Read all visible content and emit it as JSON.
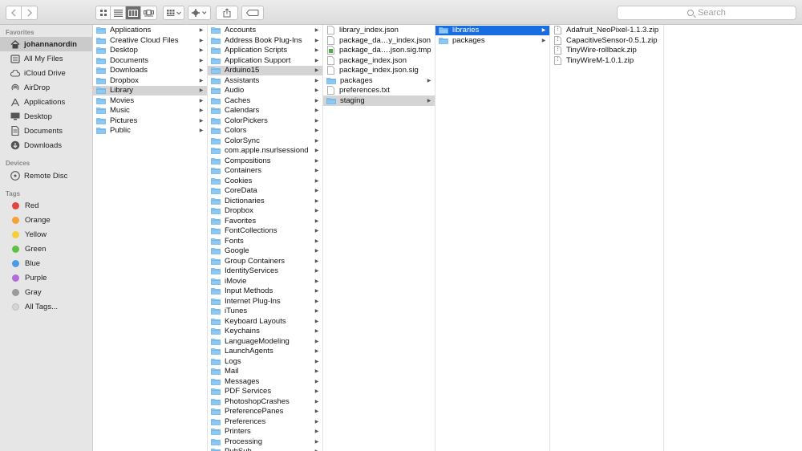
{
  "toolbar": {
    "back_icon": "chevron-left",
    "forward_icon": "chevron-right",
    "view_modes": [
      "icon-view",
      "list-view",
      "column-view",
      "cover-flow-view"
    ],
    "active_view": "column-view",
    "arrange_icon": "grid-arrange",
    "action_icon": "gear",
    "share_icon": "share",
    "tags_icon": "tag",
    "search_placeholder": "Search"
  },
  "sidebar": {
    "favorites_heading": "Favorites",
    "favorites": [
      {
        "label": "johannanordin",
        "icon": "home",
        "selected": true
      },
      {
        "label": "All My Files",
        "icon": "all-files"
      },
      {
        "label": "iCloud Drive",
        "icon": "cloud"
      },
      {
        "label": "AirDrop",
        "icon": "airdrop"
      },
      {
        "label": "Applications",
        "icon": "applications"
      },
      {
        "label": "Desktop",
        "icon": "desktop"
      },
      {
        "label": "Documents",
        "icon": "document"
      },
      {
        "label": "Downloads",
        "icon": "download"
      }
    ],
    "devices_heading": "Devices",
    "devices": [
      {
        "label": "Remote Disc",
        "icon": "disc"
      }
    ],
    "tags_heading": "Tags",
    "tags": [
      {
        "label": "Red",
        "color": "#e0443e"
      },
      {
        "label": "Orange",
        "color": "#f5a236"
      },
      {
        "label": "Yellow",
        "color": "#f3cf3a"
      },
      {
        "label": "Green",
        "color": "#5ec145"
      },
      {
        "label": "Blue",
        "color": "#4a9de2"
      },
      {
        "label": "Purple",
        "color": "#b26cd8"
      },
      {
        "label": "Gray",
        "color": "#9b9b9b"
      },
      {
        "label": "All Tags...",
        "color": "#d4d4d4"
      }
    ]
  },
  "columns": [
    {
      "items": [
        {
          "label": "Applications",
          "type": "folder"
        },
        {
          "label": "Creative Cloud Files",
          "type": "folder"
        },
        {
          "label": "Desktop",
          "type": "folder"
        },
        {
          "label": "Documents",
          "type": "folder"
        },
        {
          "label": "Downloads",
          "type": "folder"
        },
        {
          "label": "Dropbox",
          "type": "folder"
        },
        {
          "label": "Library",
          "type": "folder",
          "state": "gray"
        },
        {
          "label": "Movies",
          "type": "folder"
        },
        {
          "label": "Music",
          "type": "folder"
        },
        {
          "label": "Pictures",
          "type": "folder"
        },
        {
          "label": "Public",
          "type": "folder"
        }
      ]
    },
    {
      "items": [
        {
          "label": "Accounts",
          "type": "folder"
        },
        {
          "label": "Address Book Plug-Ins",
          "type": "folder"
        },
        {
          "label": "Application Scripts",
          "type": "folder"
        },
        {
          "label": "Application Support",
          "type": "folder"
        },
        {
          "label": "Arduino15",
          "type": "folder",
          "state": "gray"
        },
        {
          "label": "Assistants",
          "type": "folder"
        },
        {
          "label": "Audio",
          "type": "folder"
        },
        {
          "label": "Caches",
          "type": "folder"
        },
        {
          "label": "Calendars",
          "type": "folder"
        },
        {
          "label": "ColorPickers",
          "type": "folder"
        },
        {
          "label": "Colors",
          "type": "folder"
        },
        {
          "label": "ColorSync",
          "type": "folder"
        },
        {
          "label": "com.apple.nsurlsessiond",
          "type": "folder"
        },
        {
          "label": "Compositions",
          "type": "folder"
        },
        {
          "label": "Containers",
          "type": "folder"
        },
        {
          "label": "Cookies",
          "type": "folder"
        },
        {
          "label": "CoreData",
          "type": "folder"
        },
        {
          "label": "Dictionaries",
          "type": "folder"
        },
        {
          "label": "Dropbox",
          "type": "folder"
        },
        {
          "label": "Favorites",
          "type": "folder"
        },
        {
          "label": "FontCollections",
          "type": "folder"
        },
        {
          "label": "Fonts",
          "type": "folder"
        },
        {
          "label": "Google",
          "type": "folder"
        },
        {
          "label": "Group Containers",
          "type": "folder"
        },
        {
          "label": "IdentityServices",
          "type": "folder"
        },
        {
          "label": "iMovie",
          "type": "folder"
        },
        {
          "label": "Input Methods",
          "type": "folder"
        },
        {
          "label": "Internet Plug-Ins",
          "type": "folder"
        },
        {
          "label": "iTunes",
          "type": "folder"
        },
        {
          "label": "Keyboard Layouts",
          "type": "folder"
        },
        {
          "label": "Keychains",
          "type": "folder"
        },
        {
          "label": "LanguageModeling",
          "type": "folder"
        },
        {
          "label": "LaunchAgents",
          "type": "folder"
        },
        {
          "label": "Logs",
          "type": "folder"
        },
        {
          "label": "Mail",
          "type": "folder"
        },
        {
          "label": "Messages",
          "type": "folder"
        },
        {
          "label": "PDF Services",
          "type": "folder"
        },
        {
          "label": "PhotoshopCrashes",
          "type": "folder"
        },
        {
          "label": "PreferencePanes",
          "type": "folder"
        },
        {
          "label": "Preferences",
          "type": "folder"
        },
        {
          "label": "Printers",
          "type": "folder"
        },
        {
          "label": "Processing",
          "type": "folder"
        },
        {
          "label": "PubSub",
          "type": "folder"
        }
      ]
    },
    {
      "items": [
        {
          "label": "library_index.json",
          "type": "file"
        },
        {
          "label": "package_da…y_index.json",
          "type": "file"
        },
        {
          "label": "package_da….json.sig.tmp",
          "type": "file-green"
        },
        {
          "label": "package_index.json",
          "type": "file"
        },
        {
          "label": "package_index.json.sig",
          "type": "file"
        },
        {
          "label": "packages",
          "type": "folder"
        },
        {
          "label": "preferences.txt",
          "type": "file"
        },
        {
          "label": "staging",
          "type": "folder",
          "state": "gray"
        }
      ]
    },
    {
      "items": [
        {
          "label": "libraries",
          "type": "folder",
          "state": "blue"
        },
        {
          "label": "packages",
          "type": "folder"
        }
      ]
    },
    {
      "items": [
        {
          "label": "Adafruit_NeoPixel-1.1.3.zip",
          "type": "zip"
        },
        {
          "label": "CapacitiveSensor-0.5.1.zip",
          "type": "zip"
        },
        {
          "label": "TinyWire-rollback.zip",
          "type": "zip"
        },
        {
          "label": "TinyWireM-1.0.1.zip",
          "type": "zip"
        }
      ]
    }
  ],
  "colors": {
    "folder_fill": "#8ec9f4",
    "folder_tab": "#6fb2e6",
    "selection_blue": "#1a6de0",
    "selection_gray": "#d4d4d4"
  }
}
